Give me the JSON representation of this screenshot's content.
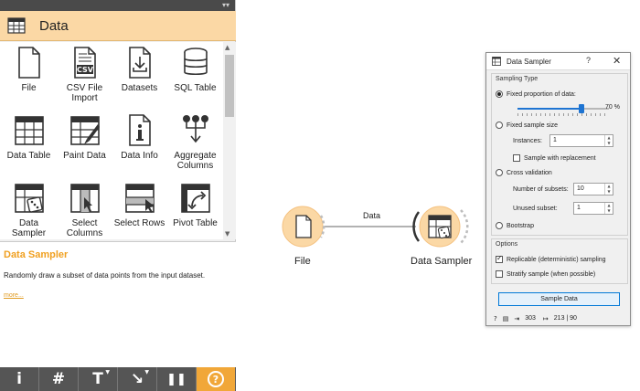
{
  "toolbox": {
    "category_title": "Data",
    "widgets": [
      {
        "label": "File",
        "icon": "file-icon"
      },
      {
        "label": "CSV File Import",
        "icon": "csv-file-icon"
      },
      {
        "label": "Datasets",
        "icon": "datasets-icon"
      },
      {
        "label": "SQL Table",
        "icon": "database-icon"
      },
      {
        "label": "Data Table",
        "icon": "table-icon"
      },
      {
        "label": "Paint Data",
        "icon": "paint-data-icon"
      },
      {
        "label": "Data Info",
        "icon": "info-icon"
      },
      {
        "label": "Aggregate Columns",
        "icon": "aggregate-icon"
      },
      {
        "label": "Data Sampler",
        "icon": "data-sampler-icon"
      },
      {
        "label": "Select Columns",
        "icon": "select-columns-icon"
      },
      {
        "label": "Select Rows",
        "icon": "select-rows-icon"
      },
      {
        "label": "Pivot Table",
        "icon": "pivot-table-icon"
      }
    ],
    "description": {
      "title": "Data Sampler",
      "text": "Randomly draw a subset of data points from the input dataset.",
      "more_link": "more..."
    },
    "footer_buttons": [
      {
        "label": "i",
        "icon": "info-button-icon"
      },
      {
        "label": "#",
        "icon": "grid-button-icon"
      },
      {
        "label": "T",
        "icon": "text-annotation-icon"
      },
      {
        "label": "↘",
        "icon": "arrow-annotation-icon"
      },
      {
        "label": "❚❚",
        "icon": "pause-icon"
      },
      {
        "label": "?",
        "icon": "help-icon"
      }
    ]
  },
  "canvas": {
    "nodes": [
      {
        "label": "File"
      },
      {
        "label": "Data Sampler"
      }
    ],
    "link_label": "Data"
  },
  "dialog": {
    "title": "Data Sampler",
    "help_button": "?",
    "close_button": "✕",
    "sampling_type": {
      "title": "Sampling Type",
      "fixed_proportion_label": "Fixed proportion of data:",
      "proportion_value": "70 %",
      "proportion_fraction": 0.7,
      "fixed_size_label": "Fixed sample size",
      "instances_label": "Instances:",
      "instances_value": "1",
      "replacement_label": "Sample with replacement",
      "cross_validation_label": "Cross validation",
      "subsets_label": "Number of subsets:",
      "subsets_value": "10",
      "unused_label": "Unused subset:",
      "unused_value": "1",
      "bootstrap_label": "Bootstrap"
    },
    "options": {
      "title": "Options",
      "replicable_label": "Replicable (deterministic) sampling",
      "replicable_checked": true,
      "stratify_label": "Stratify sample (when possible)",
      "stratify_checked": false
    },
    "sample_button": "Sample Data",
    "status": {
      "input_count": "303",
      "output_count": "213 | 90"
    }
  },
  "colors": {
    "accent_orange": "#fbd8a5",
    "help_orange": "#f1a738",
    "node_fill": "#fbd8a5",
    "slider_blue": "#1e74d2"
  }
}
